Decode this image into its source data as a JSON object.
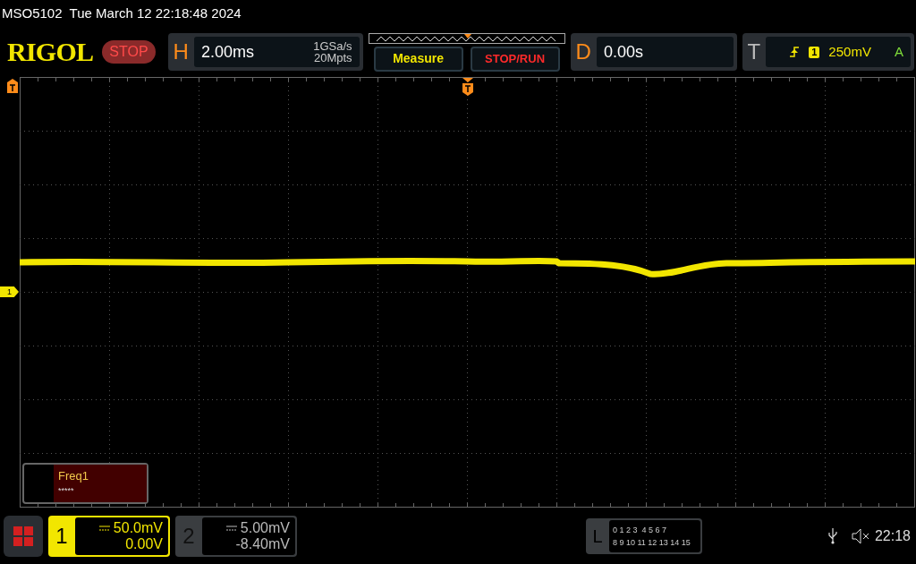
{
  "status_line": "MSO5102  Tue March 12 22:18:48 2024",
  "header": {
    "logo": "RIGOL",
    "run_state": "STOP",
    "horizontal": {
      "label": "H",
      "timebase": "2.00ms",
      "sample_rate": "1GSa/s",
      "memory_depth": "20Mpts"
    },
    "measure_button": "Measure",
    "stop_run_button": "STOP/RUN",
    "delay": {
      "label": "D",
      "value": "0.00s"
    },
    "trigger": {
      "label": "T",
      "source": "1",
      "level": "250mV",
      "mode": "A"
    }
  },
  "markers": {
    "channel_1": "1"
  },
  "measurement": {
    "name": "Freq1",
    "value": "*****"
  },
  "channels": [
    {
      "number": "1",
      "scale": "50.0mV",
      "offset": "0.00V",
      "active": true
    },
    {
      "number": "2",
      "scale": "5.00mV",
      "offset": "-8.40mV",
      "active": false
    }
  ],
  "logic": {
    "label": "L",
    "row_1": "0 1 2 3  4 5 6 7",
    "row_2": "8 9 10 11 12 13 14 15"
  },
  "clock": "22:18"
}
